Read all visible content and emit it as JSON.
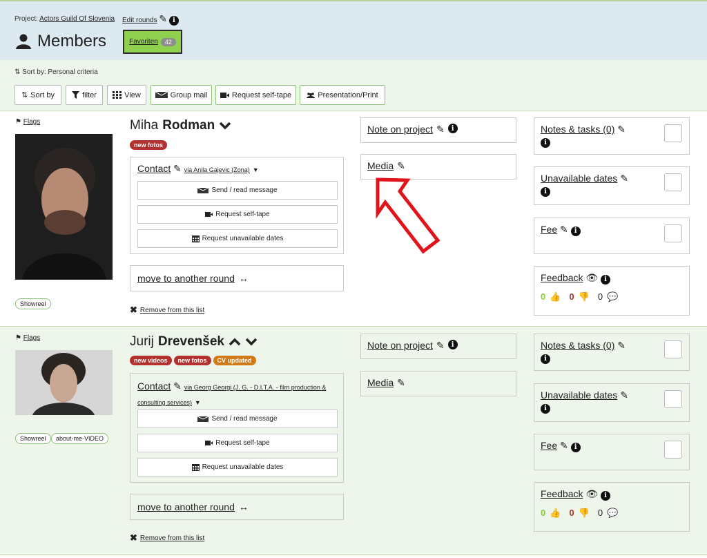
{
  "header": {
    "project_prefix": "Project:",
    "project_name": "Actors Guild Of Slovenia",
    "edit_rounds": "Edit rounds",
    "title": "Members",
    "favoriten_label": "Favoriten",
    "favoriten_count": "42"
  },
  "toolbar": {
    "sort_by_text": "Sort by: Personal criteria",
    "buttons": [
      "Sort by",
      "filter",
      "View",
      "Group mail",
      "Request self-tape",
      "Presentation/Print"
    ]
  },
  "rows": [
    {
      "flags": "Flags",
      "name_first": "Miha",
      "name_last": "Rodman",
      "badges": [
        "new fotos"
      ],
      "tags": [
        "Showreel"
      ],
      "contact_label": "Contact",
      "contact_via": "via Anila Gajevic (Zona)",
      "contact_buttons": [
        "Send / read message",
        "Request self-tape",
        "Request unavailable dates"
      ],
      "move": "move to another round",
      "remove": "Remove from this list",
      "note": "Note on project",
      "media": "Media",
      "notes_tasks": "Notes & tasks (0)",
      "unavailable": "Unavailable dates",
      "fee": "Fee",
      "feedback": "Feedback",
      "fb_up": "0",
      "fb_down": "0",
      "fb_comments": "0"
    },
    {
      "flags": "Flags",
      "name_first": "Jurij",
      "name_last": "Drevenšek",
      "badges": [
        "new videos",
        "new fotos",
        "CV updated"
      ],
      "tags": [
        "Showreel",
        "about-me-VIDEO"
      ],
      "contact_label": "Contact",
      "contact_via": "via Georg Georgi (J. G. - D.I.T.A. - film production & consulting services)",
      "contact_buttons": [
        "Send / read message",
        "Request self-tape",
        "Request unavailable dates"
      ],
      "move": "move to another round",
      "remove": "Remove from this list",
      "note": "Note on project",
      "media": "Media",
      "notes_tasks": "Notes & tasks (0)",
      "unavailable": "Unavailable dates",
      "fee": "Fee",
      "feedback": "Feedback",
      "fb_up": "0",
      "fb_down": "0",
      "fb_comments": "0"
    }
  ],
  "colors": {
    "header_bg": "#dde9f1",
    "favoriten_bg": "#8fd14f",
    "badge_red": "#b3312f",
    "badge_orange": "#d17a1a",
    "like_green": "#8dc63f",
    "dislike_red": "#b3312f",
    "arrow_red": "#e0141b"
  }
}
